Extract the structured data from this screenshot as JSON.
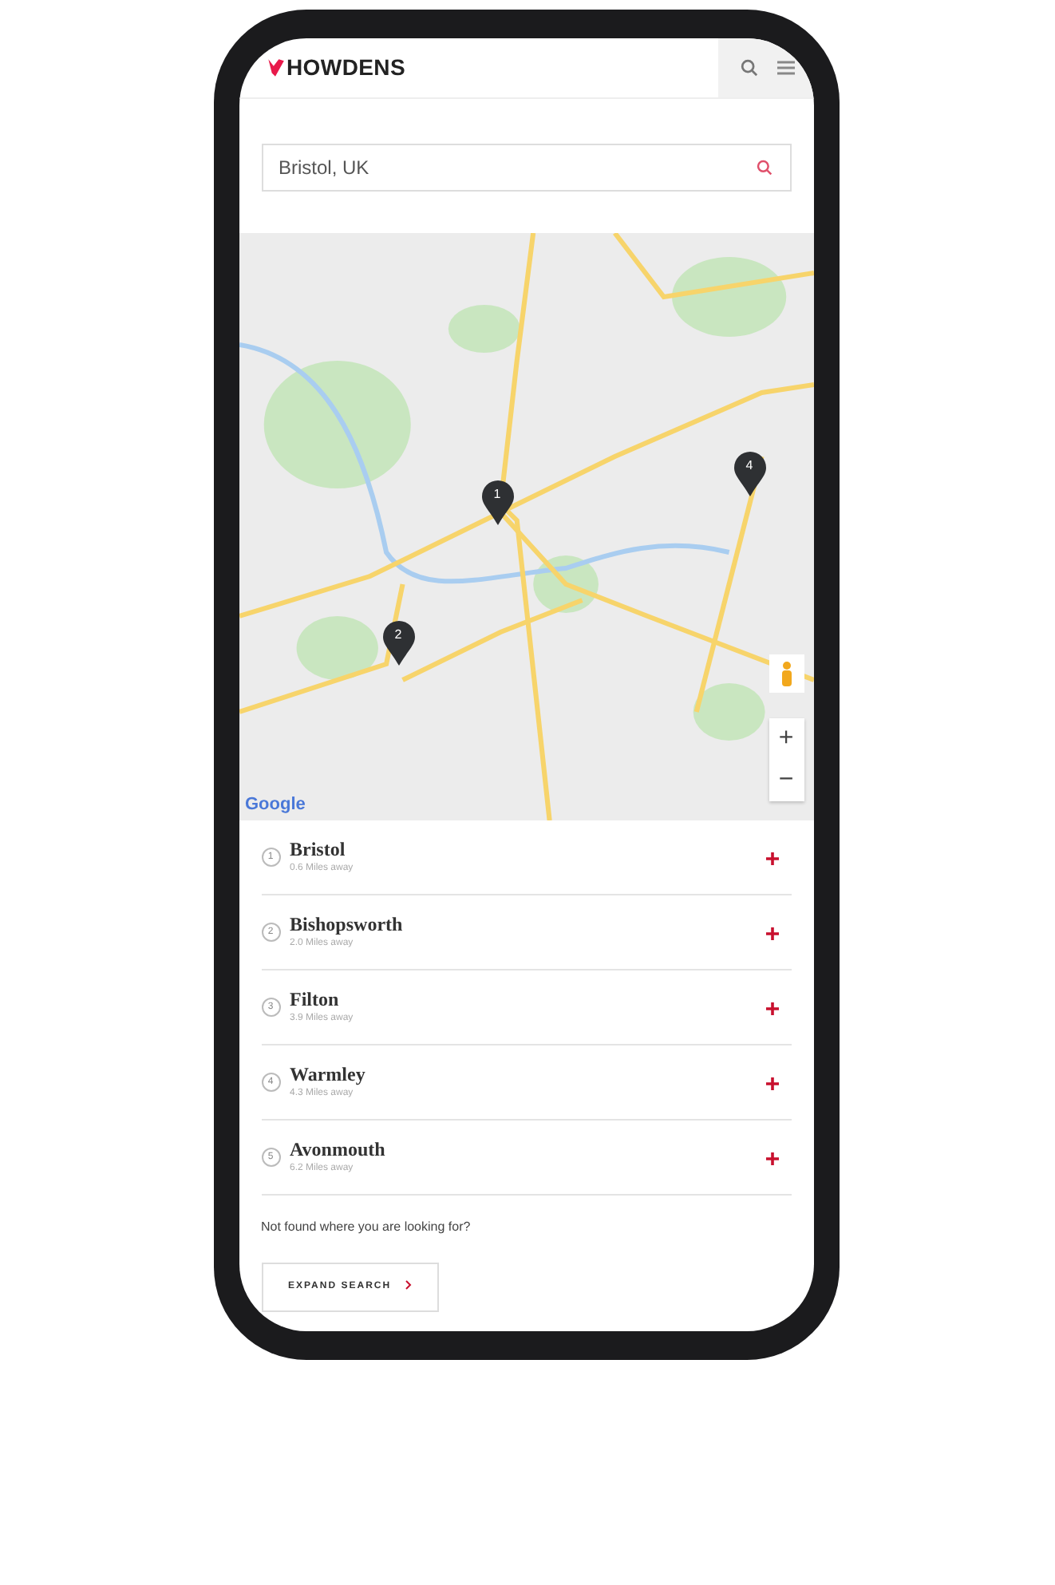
{
  "header": {
    "logo": "HOWDENS"
  },
  "search": {
    "value": "Bristol, UK"
  },
  "map": {
    "pins": [
      {
        "label": "1"
      },
      {
        "label": "2"
      },
      {
        "label": "4"
      }
    ],
    "zoom_in": "+",
    "zoom_out": "−",
    "logo": "Google"
  },
  "results": [
    {
      "number": "1",
      "name": "Bristol",
      "distance": "0.6 Miles away"
    },
    {
      "number": "2",
      "name": "Bishopsworth",
      "distance": "2.0 Miles away"
    },
    {
      "number": "3",
      "name": "Filton",
      "distance": "3.9 Miles away"
    },
    {
      "number": "4",
      "name": "Warmley",
      "distance": "4.3 Miles away"
    },
    {
      "number": "5",
      "name": "Avonmouth",
      "distance": "6.2 Miles away"
    }
  ],
  "not_found": "Not found where you are looking for?",
  "expand_button": "EXPAND SEARCH"
}
